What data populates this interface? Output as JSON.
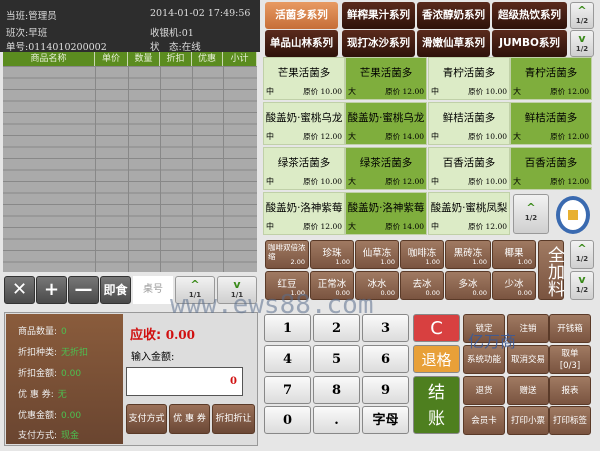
{
  "header": {
    "shift_user": "当班:管理员",
    "datetime": "2014-01-02 17:49:56",
    "shift": "班次:早班",
    "register": "收银机:01",
    "order_no": "单号:0114010200002",
    "status": "状　态:在线"
  },
  "table": {
    "columns": [
      "商品名称",
      "单价",
      "数量",
      "折扣",
      "优惠",
      "小计"
    ]
  },
  "toolbar": {
    "delete": "✕",
    "add": "+",
    "minus": "—",
    "dine": "即食",
    "table_placeholder": "桌号",
    "page_up": "1/1",
    "page_down": "1/1"
  },
  "summary": {
    "qty_label": "商品数量:",
    "qty": "0",
    "disc_type_label": "折扣种类:",
    "disc_type": "无折扣",
    "disc_amt_label": "折扣金额:",
    "disc_amt": "0.00",
    "coupon_label": "优 惠 券:",
    "coupon": "无",
    "coupon_amt_label": "优惠金额:",
    "coupon_amt": "0.00",
    "pay_label": "支付方式:",
    "pay": "现金"
  },
  "payment": {
    "due_label": "应收:",
    "due": "0.00",
    "input_label": "输入金额:",
    "input_value": "0",
    "btn_method": "支付方式",
    "btn_coupon": "优 惠 券",
    "btn_discount": "折扣折让"
  },
  "categories": [
    "活菌多系列",
    "鲜榨果汁系列",
    "香浓醇奶系列",
    "超级热饮系列",
    "单品山林系列",
    "现打冰沙系列",
    "滑嫩仙草系列",
    "JUMBO系列"
  ],
  "cat_page": "1/2",
  "products": [
    {
      "name": "芒果活菌多",
      "size": "中",
      "price": "原价 10.00"
    },
    {
      "name": "芒果活菌多",
      "size": "大",
      "price": "原价 12.00"
    },
    {
      "name": "青柠活菌多",
      "size": "中",
      "price": "原价 10.00"
    },
    {
      "name": "青柠活菌多",
      "size": "大",
      "price": "原价 12.00"
    },
    {
      "name": "酸盖奶·蜜桃乌龙",
      "size": "中",
      "price": "原价 12.00"
    },
    {
      "name": "酸盖奶·蜜桃乌龙",
      "size": "大",
      "price": "原价 14.00"
    },
    {
      "name": "鲜桔活菌多",
      "size": "中",
      "price": "原价 10.00"
    },
    {
      "name": "鲜桔活菌多",
      "size": "大",
      "price": "原价 12.00"
    },
    {
      "name": "绿茶活菌多",
      "size": "中",
      "price": "原价 10.00"
    },
    {
      "name": "绿茶活菌多",
      "size": "大",
      "price": "原价 12.00"
    },
    {
      "name": "百香活菌多",
      "size": "中",
      "price": "原价 10.00"
    },
    {
      "name": "百香活菌多",
      "size": "大",
      "price": "原价 12.00"
    },
    {
      "name": "酸盖奶·洛神紫莓",
      "size": "中",
      "price": "原价 12.00"
    },
    {
      "name": "酸盖奶·洛神紫莓",
      "size": "大",
      "price": "原价 14.00"
    },
    {
      "name": "酸盖奶·蜜桃凤梨",
      "size": "中",
      "price": "原价 12.00"
    }
  ],
  "product_page": "1/2",
  "toppings": [
    {
      "name": "咖啡双倍浓缩",
      "price": "2.00"
    },
    {
      "name": "珍珠",
      "price": "1.00"
    },
    {
      "name": "仙草冻",
      "price": "1.00"
    },
    {
      "name": "咖啡冻",
      "price": "1.00"
    },
    {
      "name": "黑砖冻",
      "price": "1.00"
    },
    {
      "name": "椰果",
      "price": "1.00"
    },
    {
      "name": "红豆",
      "price": "1.00"
    },
    {
      "name": "正常冰",
      "price": "0.00"
    },
    {
      "name": "冰水",
      "price": "0.00"
    },
    {
      "name": "去冰",
      "price": "0.00"
    },
    {
      "name": "多冰",
      "price": "0.00"
    },
    {
      "name": "少冰",
      "price": "0.00"
    }
  ],
  "all_toppings": "全加料",
  "topping_page": "1/2",
  "keypad": [
    "1",
    "2",
    "3",
    "4",
    "5",
    "6",
    "7",
    "8",
    "9",
    "0",
    ".",
    "字母"
  ],
  "clear": "C",
  "backspace": "退格",
  "checkout": "结账",
  "functions": [
    "锁定",
    "注销",
    "开钱箱",
    "系统功能",
    "取消交易",
    "取单\n[0/3]",
    "退货",
    "赠送",
    "报表",
    "会员卡",
    "打印小票",
    "打印标签"
  ],
  "watermark": {
    "url": "www.ews88.com",
    "brand": "亿万商"
  },
  "colors": {
    "green": "#5b8c1f",
    "brown": "#6b4836",
    "accent": "#c66e38",
    "due": "#d01010"
  }
}
